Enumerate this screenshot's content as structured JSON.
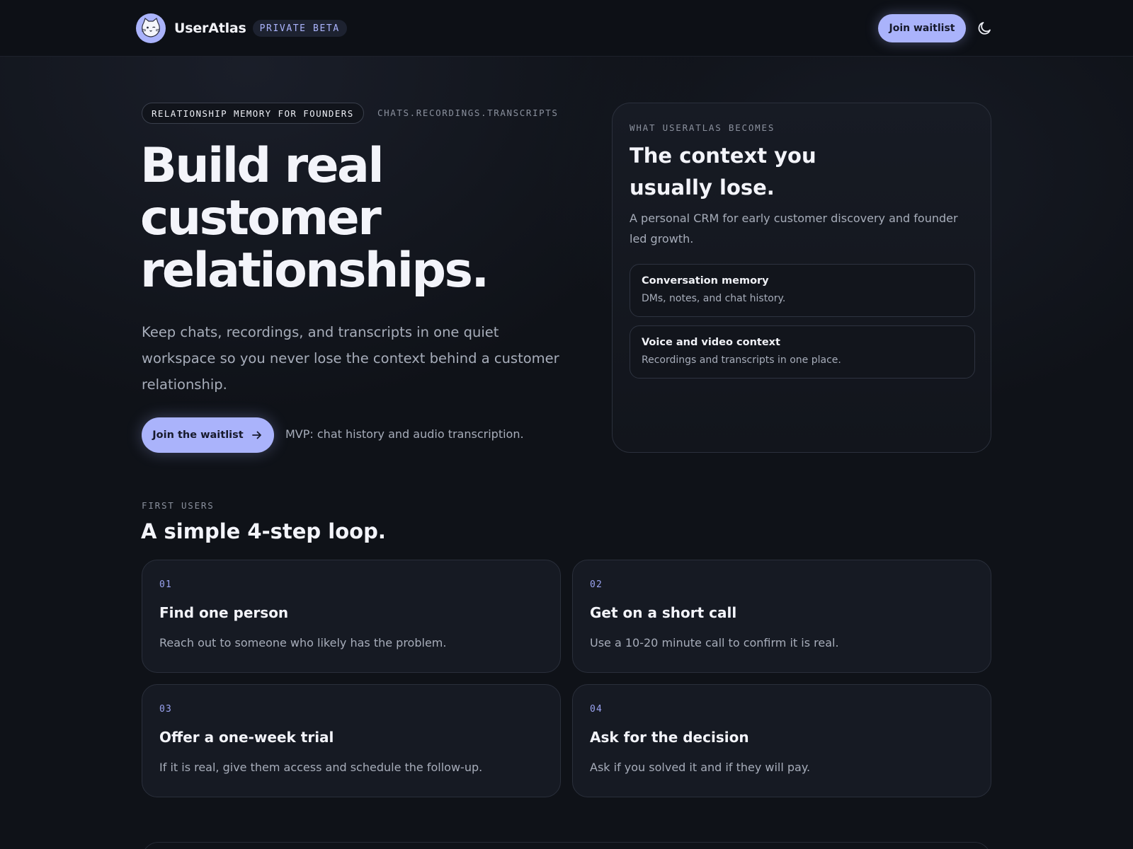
{
  "header": {
    "brand_name": "UserAtlas",
    "beta_badge": "PRIVATE BETA",
    "cta_label": "Join waitlist",
    "theme_icon": "moon-icon",
    "logo_icon": "cat-face-logo"
  },
  "hero": {
    "pill": "RELATIONSHIP MEMORY FOR FOUNDERS",
    "tags": "CHATS.RECORDINGS.TRANSCRIPTS",
    "title_line_1": "Build real",
    "title_line_2": "customer",
    "title_line_3": "relationships.",
    "subtitle": "Keep chats, recordings, and transcripts in one quiet workspace so you never lose the context behind a customer relationship.",
    "cta_label": "Join the waitlist",
    "cta_icon": "arrow-right-icon",
    "mvp_note": "MVP: chat history and audio transcription."
  },
  "hero_card": {
    "kicker": "WHAT USERATLAS BECOMES",
    "title": "The context you usually lose.",
    "description": "A personal CRM for early customer discovery and founder led growth.",
    "features": [
      {
        "title": "Conversation memory",
        "description": "DMs, notes, and chat history."
      },
      {
        "title": "Voice and video context",
        "description": "Recordings and transcripts in one place."
      }
    ]
  },
  "steps_section": {
    "kicker": "FIRST USERS",
    "title": "A simple 4-step loop.",
    "steps": [
      {
        "number": "01",
        "title": "Find one person",
        "description": "Reach out to someone who likely has the problem."
      },
      {
        "number": "02",
        "title": "Get on a short call",
        "description": "Use a 10-20 minute call to confirm it is real."
      },
      {
        "number": "03",
        "title": "Offer a one-week trial",
        "description": "If it is real, give them access and schedule the follow-up."
      },
      {
        "number": "04",
        "title": "Ask for the decision",
        "description": "Ask if you solved it and if they will pay."
      }
    ]
  },
  "colors": {
    "background": "#0f1218",
    "accent": "#aab3fb",
    "text_primary": "#f3f4fa",
    "text_muted": "#a7adba"
  }
}
